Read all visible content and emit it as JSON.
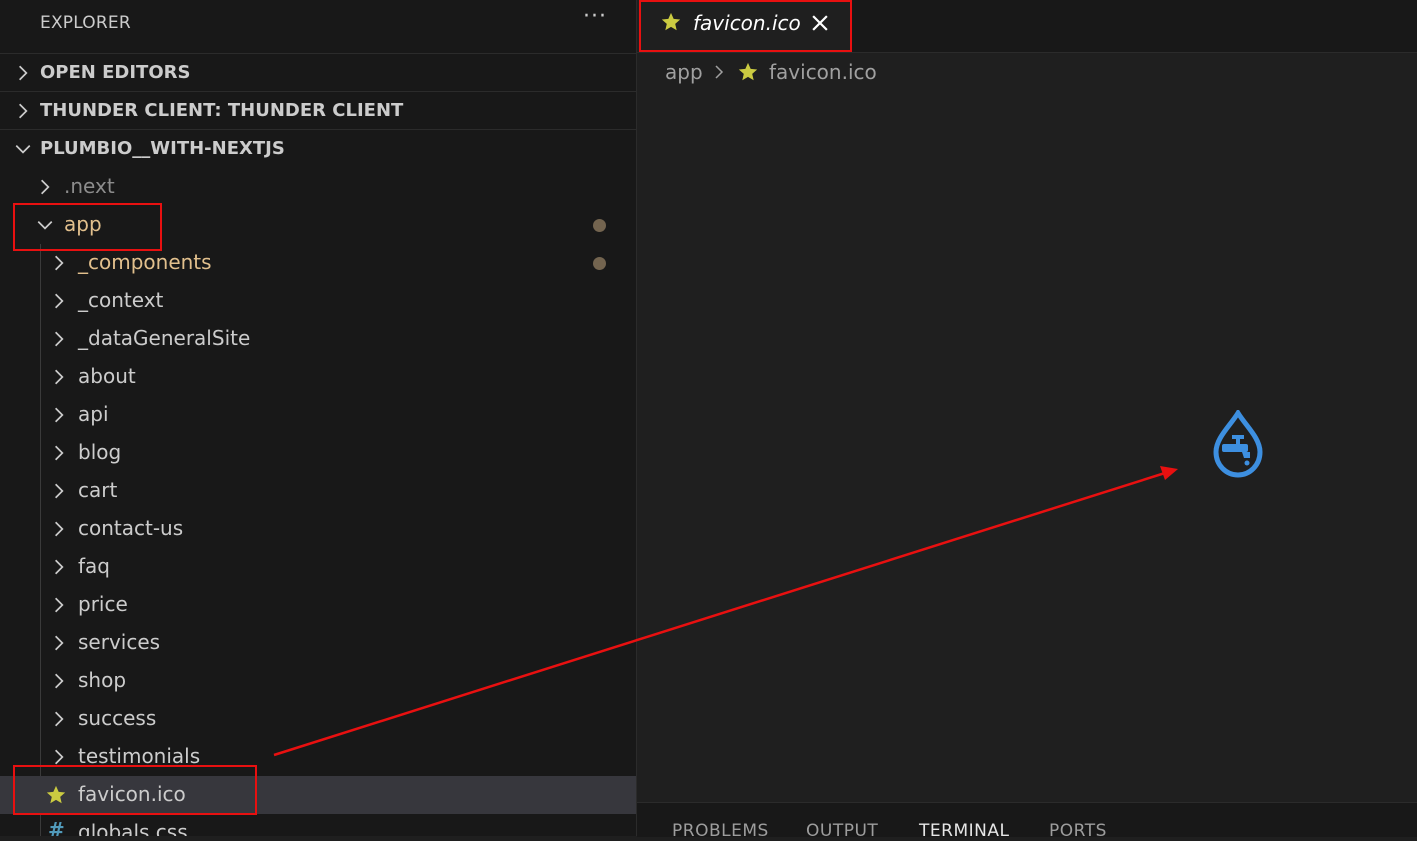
{
  "sidebar": {
    "title": "EXPLORER",
    "more": "···",
    "sections": {
      "open_editors": "OPEN EDITORS",
      "thunder_client": "THUNDER CLIENT: THUNDER CLIENT",
      "project": "PLUMBIO__WITH-NEXTJS"
    },
    "tree": {
      "next": ".next",
      "app": "app",
      "children": [
        "_components",
        "_context",
        "_dataGeneralSite",
        "about",
        "api",
        "blog",
        "cart",
        "contact-us",
        "faq",
        "price",
        "services",
        "shop",
        "success",
        "testimonials"
      ],
      "favicon": "favicon.ico",
      "globals": "globals.css"
    },
    "colors": {
      "modified_folder": "#e2c08d",
      "ignored": "#8c8c8c",
      "star": "#cbcb41"
    }
  },
  "editor": {
    "tab_label": "favicon.ico",
    "breadcrumb": {
      "folder": "app",
      "file": "favicon.ico"
    },
    "preview_icon": "water-faucet-drop-icon"
  },
  "panel": {
    "tabs": [
      "PROBLEMS",
      "OUTPUT",
      "TERMINAL",
      "PORTS"
    ],
    "active": "TERMINAL"
  },
  "annotation_color": "#e81010"
}
